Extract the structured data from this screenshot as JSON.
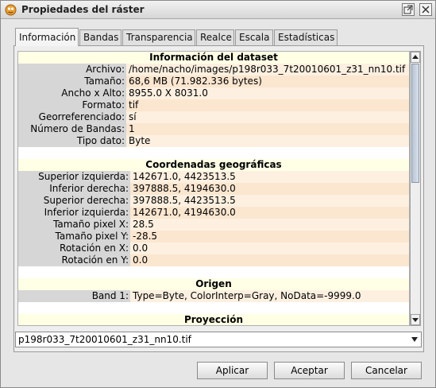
{
  "window": {
    "title": "Propiedades del ráster"
  },
  "tabs": [
    "Información",
    "Bandas",
    "Transparencia",
    "Realce",
    "Escala",
    "Estadísticas"
  ],
  "dataset": {
    "title": "Información del dataset",
    "rows": [
      {
        "label": "Archivo:",
        "value": "/home/nacho/images/p198r033_7t20010601_z31_nn10.tif"
      },
      {
        "label": "Tamaño:",
        "value": "68,6 MB (71.982.336 bytes)"
      },
      {
        "label": "Ancho x Alto:",
        "value": "8955.0 X 8031.0"
      },
      {
        "label": "Formato:",
        "value": "tif"
      },
      {
        "label": "Georreferenciado:",
        "value": "sí"
      },
      {
        "label": "Número de Bandas:",
        "value": "1"
      },
      {
        "label": "Tipo dato:",
        "value": "Byte"
      }
    ]
  },
  "geo": {
    "title": "Coordenadas geográficas",
    "rows": [
      {
        "label": "Superior izquierda:",
        "value": "142671.0, 4423513.5"
      },
      {
        "label": "Inferior derecha:",
        "value": "397888.5, 4194630.0"
      },
      {
        "label": "Superior derecha:",
        "value": "397888.5, 4423513.5"
      },
      {
        "label": "Inferior izquierda:",
        "value": "142671.0, 4194630.0"
      },
      {
        "label": "Tamaño pixel X:",
        "value": "28.5"
      },
      {
        "label": "Tamaño pixel Y:",
        "value": "-28.5"
      },
      {
        "label": "Rotación en X:",
        "value": "0.0"
      },
      {
        "label": "Rotación en Y:",
        "value": "0.0"
      }
    ]
  },
  "origin": {
    "title": "Origen",
    "rows": [
      {
        "label": "Band 1:",
        "value": "Type=Byte, ColorInterp=Gray, NoData=-9999.0"
      }
    ]
  },
  "projection": {
    "title": "Proyección"
  },
  "file_select": {
    "value": "p198r033_7t20010601_z31_nn10.tif"
  },
  "buttons": {
    "apply": "Aplicar",
    "accept": "Aceptar",
    "cancel": "Cancelar"
  },
  "colors": {
    "section_bg": "#ffffe6",
    "label_bg": "#d6d6d6",
    "value_bg": "#fdf0e0"
  }
}
